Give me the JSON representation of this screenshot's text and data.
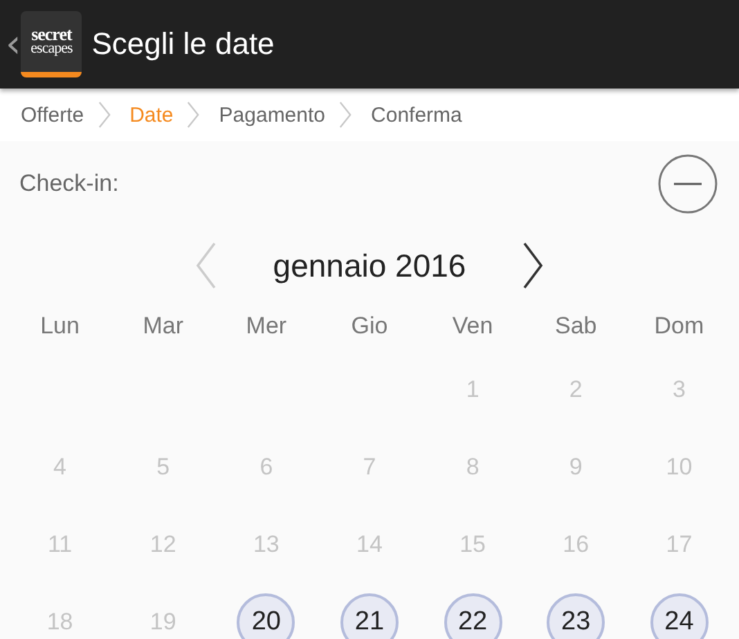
{
  "app_bar": {
    "back": "‹",
    "logo": {
      "line_1": "secret",
      "line_2": "escapes"
    },
    "title": "Scegli le date"
  },
  "breadcrumb": [
    {
      "label": "Offerte",
      "selected": false
    },
    {
      "label": "Date",
      "selected": true
    },
    {
      "label": "Pagamento",
      "selected": false
    },
    {
      "label": "Conferma",
      "selected": false
    }
  ],
  "check_in": {
    "label": "Check-in:"
  },
  "calendar": {
    "month": "gennaio 2016",
    "weekdays": [
      "Lun",
      "Mar",
      "Mer",
      "Gio",
      "Ven",
      "Sab",
      "Dom"
    ],
    "weeks": [
      [
        {
          "kind": "blank"
        },
        {
          "kind": "blank"
        },
        {
          "kind": "blank"
        },
        {
          "kind": "blank"
        },
        {
          "kind": "day",
          "label": "1",
          "available": false
        },
        {
          "kind": "day",
          "label": "2",
          "available": false
        },
        {
          "kind": "day",
          "label": "3",
          "available": false
        }
      ],
      [
        {
          "kind": "day",
          "label": "4",
          "available": false
        },
        {
          "kind": "day",
          "label": "5",
          "available": false
        },
        {
          "kind": "day",
          "label": "6",
          "available": false
        },
        {
          "kind": "day",
          "label": "7",
          "available": false
        },
        {
          "kind": "day",
          "label": "8",
          "available": false
        },
        {
          "kind": "day",
          "label": "9",
          "available": false
        },
        {
          "kind": "day",
          "label": "10",
          "available": false
        }
      ],
      [
        {
          "kind": "day",
          "label": "11",
          "available": false
        },
        {
          "kind": "day",
          "label": "12",
          "available": false
        },
        {
          "kind": "day",
          "label": "13",
          "available": false
        },
        {
          "kind": "day",
          "label": "14",
          "available": false
        },
        {
          "kind": "day",
          "label": "15",
          "available": false
        },
        {
          "kind": "day",
          "label": "16",
          "available": false
        },
        {
          "kind": "day",
          "label": "17",
          "available": false
        }
      ],
      [
        {
          "kind": "day",
          "label": "18",
          "available": false
        },
        {
          "kind": "day",
          "label": "19",
          "available": false
        },
        {
          "kind": "day",
          "label": "20",
          "available": true
        },
        {
          "kind": "day",
          "label": "21",
          "available": true
        },
        {
          "kind": "day",
          "label": "22",
          "available": true
        },
        {
          "kind": "day",
          "label": "23",
          "available": true
        },
        {
          "kind": "day",
          "label": "24",
          "available": true
        }
      ]
    ]
  }
}
